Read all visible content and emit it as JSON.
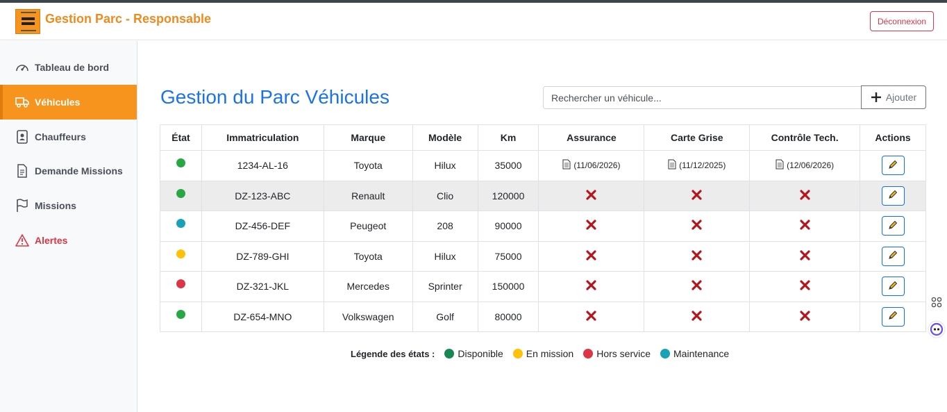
{
  "header": {
    "title": "Gestion Parc - Responsable",
    "logout_label": "Déconnexion"
  },
  "sidebar": {
    "items": [
      {
        "label": "Tableau de bord",
        "icon": "dashboard-gauge-icon"
      },
      {
        "label": "Véhicules",
        "icon": "truck-icon",
        "active": true
      },
      {
        "label": "Chauffeurs",
        "icon": "driver-badge-icon"
      },
      {
        "label": "Demande Missions",
        "icon": "document-icon"
      },
      {
        "label": "Missions",
        "icon": "flag-icon"
      },
      {
        "label": "Alertes",
        "icon": "warning-triangle-icon"
      }
    ]
  },
  "main": {
    "title": "Gestion du Parc Véhicules",
    "search_placeholder": "Rechercher un véhicule...",
    "add_label": "Ajouter"
  },
  "table": {
    "headers": [
      "État",
      "Immatriculation",
      "Marque",
      "Modèle",
      "Km",
      "Assurance",
      "Carte Grise",
      "Contrôle Tech.",
      "Actions"
    ],
    "rows": [
      {
        "etat": "disponible",
        "immat": "1234-AL-16",
        "marque": "Toyota",
        "modele": "Hilux",
        "km": "35000",
        "assurance": "(11/06/2026)",
        "carte_grise": "(11/12/2025)",
        "controle": "(12/06/2026)"
      },
      {
        "etat": "disponible",
        "immat": "DZ-123-ABC",
        "marque": "Renault",
        "modele": "Clio",
        "km": "120000",
        "assurance": null,
        "carte_grise": null,
        "controle": null
      },
      {
        "etat": "maintenance",
        "immat": "DZ-456-DEF",
        "marque": "Peugeot",
        "modele": "208",
        "km": "90000",
        "assurance": null,
        "carte_grise": null,
        "controle": null
      },
      {
        "etat": "en_mission",
        "immat": "DZ-789-GHI",
        "marque": "Toyota",
        "modele": "Hilux",
        "km": "75000",
        "assurance": null,
        "carte_grise": null,
        "controle": null
      },
      {
        "etat": "hors_service",
        "immat": "DZ-321-JKL",
        "marque": "Mercedes",
        "modele": "Sprinter",
        "km": "150000",
        "assurance": null,
        "carte_grise": null,
        "controle": null
      },
      {
        "etat": "disponible",
        "immat": "DZ-654-MNO",
        "marque": "Volkswagen",
        "modele": "Golf",
        "km": "80000",
        "assurance": null,
        "carte_grise": null,
        "controle": null
      }
    ]
  },
  "legend": {
    "label": "Légende des états :",
    "items": [
      {
        "key": "disponible",
        "label": "Disponible"
      },
      {
        "key": "en_mission",
        "label": "En mission"
      },
      {
        "key": "hors_service",
        "label": "Hors service"
      },
      {
        "key": "maintenance",
        "label": "Maintenance"
      }
    ]
  },
  "colors": {
    "accent": "#f7941d",
    "title_blue": "#1a73e8",
    "disponible": "#28a745",
    "disponible_legend": "#198754",
    "en_mission": "#ffc107",
    "hors_service": "#dc3545",
    "maintenance": "#17a2b8"
  }
}
